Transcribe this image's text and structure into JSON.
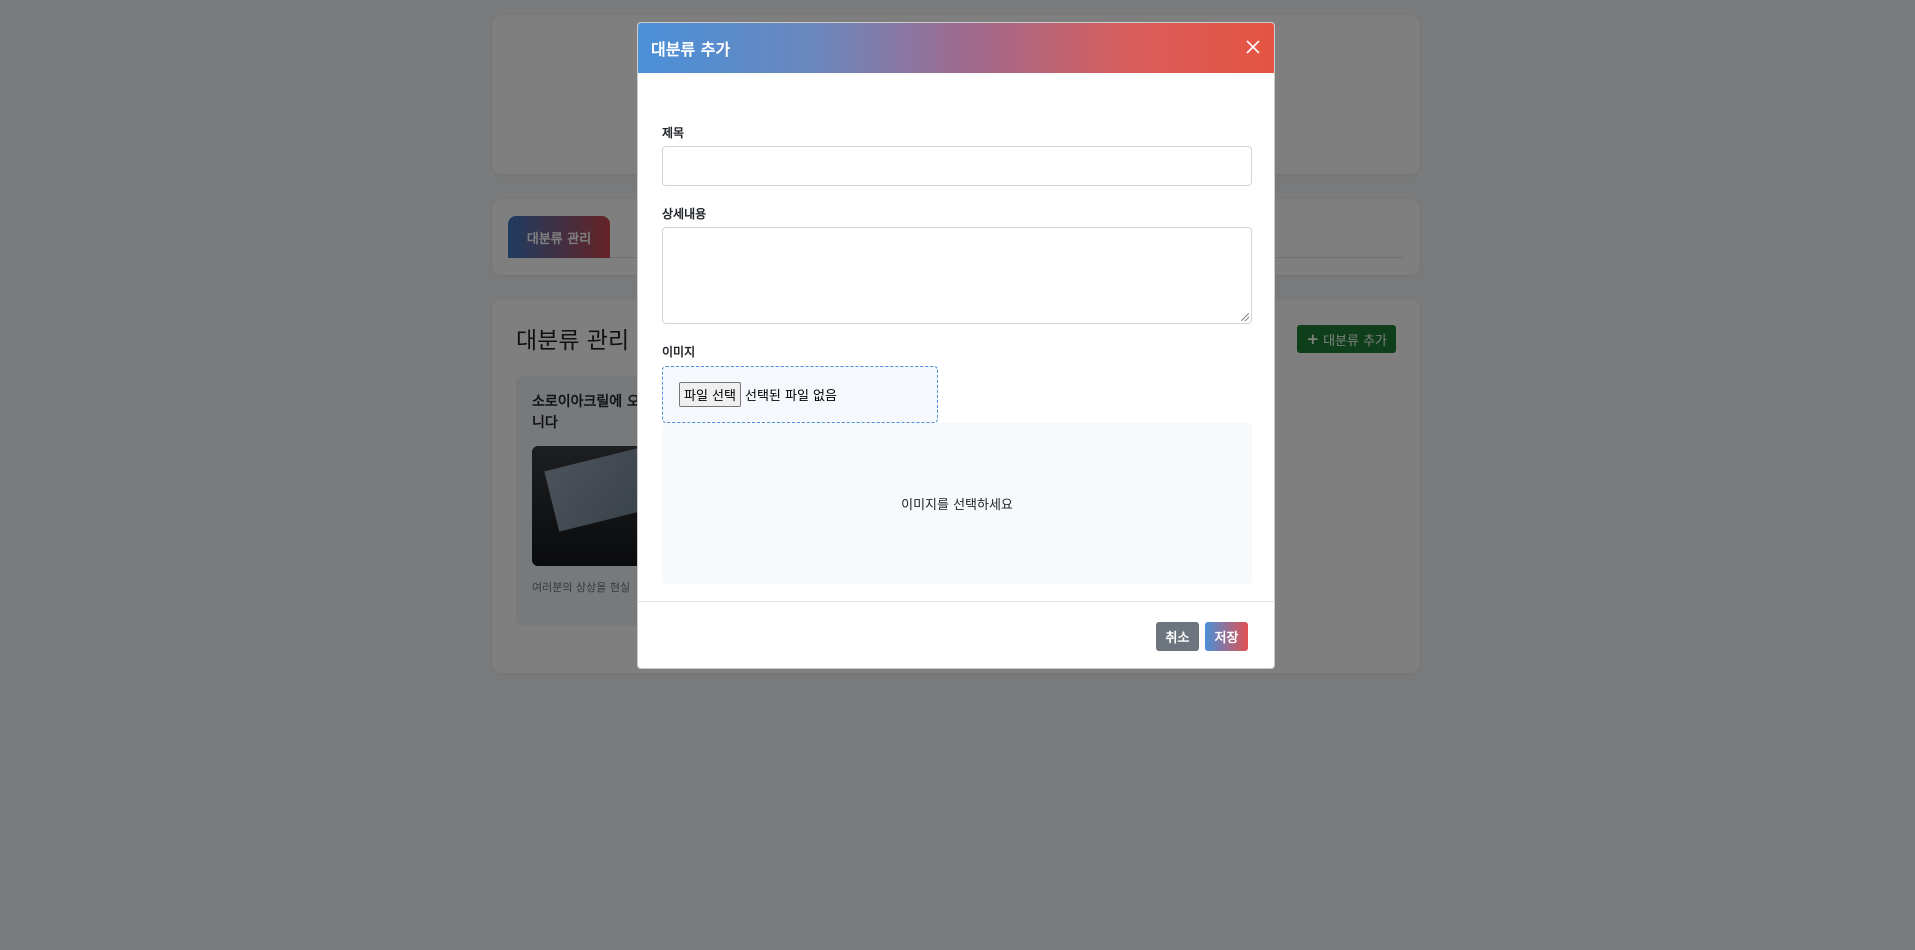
{
  "background": {
    "tabs": [
      {
        "label": "대분류 관리"
      }
    ],
    "main": {
      "title": "대분류 관리",
      "add_button_label": "대분류 추가",
      "items": [
        {
          "title": "소로이아크릴에 오 니다",
          "title_line1": "소로이아크릴에 오",
          "title_line2": "니다",
          "description": "여러분의 상상을 현실"
        }
      ]
    },
    "colors": {
      "accent_success": "#1e7e34"
    }
  },
  "modal": {
    "title": "대분류 추가",
    "fields": {
      "title_label": "제목",
      "title_value": "",
      "description_label": "상세내용",
      "description_value": "",
      "image_label": "이미지",
      "file_button_label": "파일 선택",
      "file_status": "선택된 파일 없음",
      "preview_placeholder": "이미지를 선택하세요"
    },
    "footer": {
      "cancel_label": "취소",
      "save_label": "저장"
    },
    "colors": {
      "header_gradient_start": "#4a90d9",
      "header_gradient_end": "#e55442",
      "cancel": "#6c757d"
    }
  }
}
